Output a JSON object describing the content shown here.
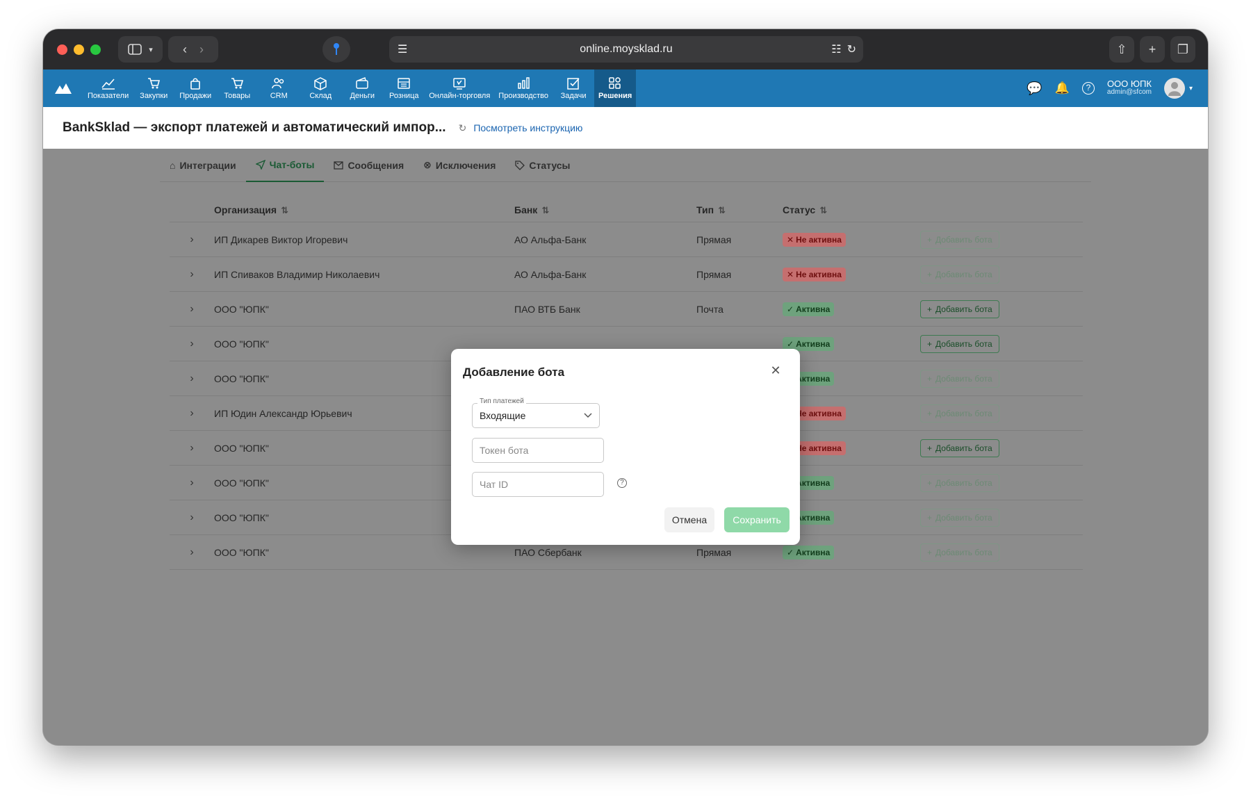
{
  "browser": {
    "url": "online.moysklad.ru"
  },
  "nav": {
    "items": [
      {
        "label": "Показатели",
        "icon": "chart-icon"
      },
      {
        "label": "Закупки",
        "icon": "cart-icon"
      },
      {
        "label": "Продажи",
        "icon": "bag-icon"
      },
      {
        "label": "Товары",
        "icon": "cart-icon"
      },
      {
        "label": "CRM",
        "icon": "users-icon"
      },
      {
        "label": "Склад",
        "icon": "box-icon"
      },
      {
        "label": "Деньги",
        "icon": "wallet-icon"
      },
      {
        "label": "Розница",
        "icon": "register-icon"
      },
      {
        "label": "Онлайн-торговля",
        "icon": "online-icon"
      },
      {
        "label": "Производство",
        "icon": "factory-icon"
      },
      {
        "label": "Задачи",
        "icon": "task-icon"
      },
      {
        "label": "Решения",
        "icon": "apps-icon"
      }
    ],
    "active": "Решения",
    "user_name": "ООО ЮПК",
    "user_email": "admin@sfcom"
  },
  "header": {
    "title": "BankSklad — экспорт платежей и автоматический импор...",
    "instruction_link": "Посмотреть инструкцию"
  },
  "tabs": [
    {
      "label": "Интеграции",
      "icon": "home-icon"
    },
    {
      "label": "Чат-боты",
      "icon": "send-icon"
    },
    {
      "label": "Сообщения",
      "icon": "mail-icon"
    },
    {
      "label": "Исключения",
      "icon": "cancel-circle-icon"
    },
    {
      "label": "Статусы",
      "icon": "tag-icon"
    }
  ],
  "active_tab": "Чат-боты",
  "table": {
    "columns": [
      "Организация",
      "Банк",
      "Тип",
      "Статус"
    ],
    "add_bot_label": "Добавить бота",
    "rows": [
      {
        "org": "ИП Дикарев Виктор Игоревич",
        "bank": "АО Альфа-Банк",
        "type": "Прямая",
        "status": "Не активна",
        "status_kind": "inactive",
        "add_enabled": false
      },
      {
        "org": "ИП Спиваков Владимир Николаевич",
        "bank": "АО Альфа-Банк",
        "type": "Прямая",
        "status": "Не активна",
        "status_kind": "inactive",
        "add_enabled": false
      },
      {
        "org": "ООО \"ЮПК\"",
        "bank": "ПАО ВТБ Банк",
        "type": "Почта",
        "status": "Активна",
        "status_kind": "active",
        "add_enabled": true
      },
      {
        "org": "ООО \"ЮПК\"",
        "bank": "",
        "type": "",
        "status": "Активна",
        "status_kind": "active",
        "add_enabled": true
      },
      {
        "org": "ООО \"ЮПК\"",
        "bank": "",
        "type": "",
        "status": "Активна",
        "status_kind": "active",
        "add_enabled": false
      },
      {
        "org": "ИП Юдин Александр Юрьевич",
        "bank": "",
        "type": "",
        "status": "Не активна",
        "status_kind": "inactive",
        "add_enabled": false
      },
      {
        "org": "ООО \"ЮПК\"",
        "bank": "",
        "type": "",
        "status": "Не активна",
        "status_kind": "inactive",
        "add_enabled": true
      },
      {
        "org": "ООО \"ЮПК\"",
        "bank": "",
        "type": "",
        "status": "Активна",
        "status_kind": "active",
        "add_enabled": false
      },
      {
        "org": "ООО \"ЮПК\"",
        "bank": "",
        "type": "",
        "status": "Активна",
        "status_kind": "active",
        "add_enabled": false
      },
      {
        "org": "ООО \"ЮПК\"",
        "bank": "ПАО Сбербанк",
        "type": "Прямая",
        "status": "Активна",
        "status_kind": "active",
        "add_enabled": false
      }
    ]
  },
  "modal": {
    "title": "Добавление бота",
    "payment_type_label": "Тип платежей",
    "payment_type_value": "Входящие",
    "token_placeholder": "Токен бота",
    "chat_id_placeholder": "Чат ID",
    "cancel_label": "Отмена",
    "save_label": "Сохранить"
  },
  "colors": {
    "nav_bg": "#1f78b4",
    "accent_green": "#1a5a34",
    "save_button": "#8fd9a8"
  }
}
